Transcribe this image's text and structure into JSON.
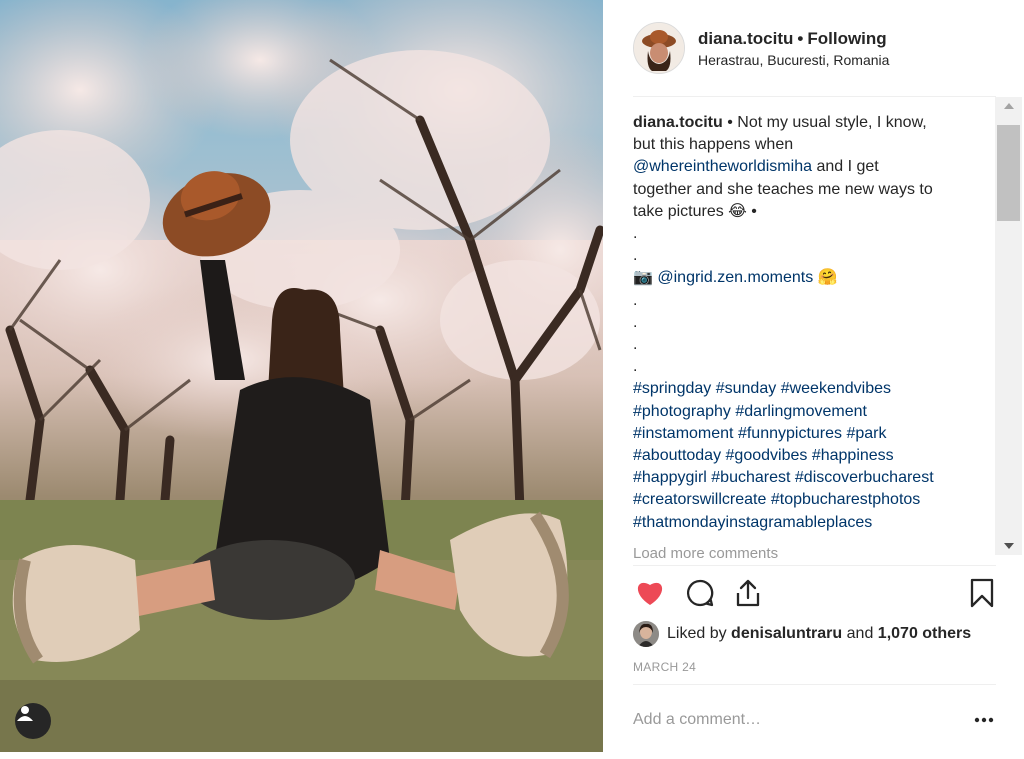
{
  "post": {
    "username": "diana.tocitu",
    "follow_status": "Following",
    "location": "Herastrau, Bucuresti, Romania",
    "caption_lines": [
      "Not my usual style, I know,",
      "but this happens when",
      "@whereintheworldismiha",
      "and I get",
      "together and she teaches me new ways to",
      "take pictures 😂 •",
      ".",
      ".",
      "📷",
      "@ingrid.zen.moments",
      "🤗",
      ".",
      ".",
      ".",
      "."
    ],
    "hashtag_lines": [
      [
        "#springday",
        "#sunday",
        "#weekendvibes"
      ],
      [
        "#photography",
        "#darlingmovement"
      ],
      [
        "#instamoment",
        "#funnypictures",
        "#park"
      ],
      [
        "#abouttoday",
        "#goodvibes",
        "#happiness"
      ],
      [
        "#happygirl",
        "#bucharest",
        "#discoverbucharest"
      ],
      [
        "#creatorswillcreate",
        "#topbucharestphotos"
      ],
      [
        "#thatmondayinstagramableplaces"
      ]
    ],
    "load_more": "Load more comments",
    "likes": {
      "prefix": "Liked by",
      "user": "denisaluntraru",
      "and": "and",
      "count": "1,070 others"
    },
    "date": "MARCH 24",
    "comment_placeholder": "Add a comment…",
    "liked": true
  },
  "icons": {
    "like": "heart-icon",
    "comment": "comment-icon",
    "share": "share-icon",
    "save": "bookmark-icon",
    "more": "more-icon",
    "tag": "user-tag-icon"
  },
  "colors": {
    "heart": "#ed4956",
    "link": "#003569",
    "muted": "#999999",
    "text": "#262626"
  }
}
